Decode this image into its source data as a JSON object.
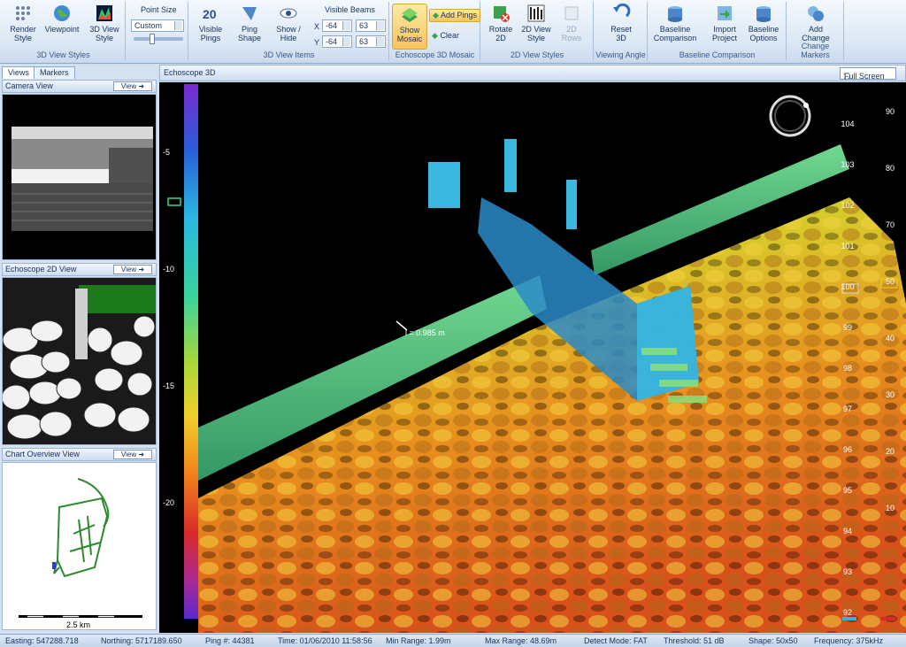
{
  "ribbon": {
    "render_style": "Render\nStyle",
    "viewpoint": "Viewpoint",
    "view_style_3d": "3D View\nStyle",
    "point_size_label": "Point Size",
    "point_size_value": "Custom",
    "group_3d_view_styles": "3D View Styles",
    "visible_pings": "Visible\nPings",
    "ping_shape": "Ping\nShape",
    "show_hide": "Show /\nHide",
    "group_3d_view_items": "3D View Items",
    "visible_beams_label": "Visible Beams",
    "x_label": "X",
    "y_label": "Y",
    "x_min": "-64",
    "x_max": "63",
    "y_min": "-64",
    "y_max": "63",
    "show_mosaic": "Show\nMosaic",
    "add_pings": "Add Pings",
    "clear": "Clear",
    "group_mosaic": "Echoscope 3D Mosaic",
    "rotate_2d": "Rotate\n2D",
    "view_style_2d": "2D View\nStyle",
    "rows_2d": "2D\nRows",
    "group_2d_view_styles": "2D View Styles",
    "reset_3d": "Reset\n3D",
    "group_viewing_angle": "Viewing Angle",
    "baseline_comparison": "Baseline\nComparison",
    "import_project": "Import\nProject",
    "baseline_options": "Baseline\nOptions",
    "group_baseline": "Baseline Comparison",
    "add_change": "Add\nChange",
    "group_change_markers": "Change Markers"
  },
  "left": {
    "tab_views": "Views",
    "tab_markers": "Markers",
    "camera_view": "Camera View",
    "echoscope_2d_view": "Echoscope 2D View",
    "chart_overview_view": "Chart Overview View",
    "view_button": "View",
    "scale_label": "2.5 km"
  },
  "main": {
    "title": "Echoscope 3D",
    "full_screen": "Full Screen",
    "measurement": "l = 0.985 m",
    "depth_ticks": [
      "-5",
      "-10",
      "-15",
      "-20"
    ],
    "right_ticks_inner": [
      "104",
      "103",
      "102",
      "101",
      "100",
      "99",
      "98",
      "97",
      "96",
      "95",
      "94",
      "93",
      "92"
    ],
    "right_ticks_outer": [
      "90",
      "80",
      "70",
      "50",
      "40",
      "30",
      "20",
      "10"
    ]
  },
  "status": {
    "easting": "Easting:  547288.718",
    "northing": "Northing:  5717189.650",
    "ping": "Ping #:  44381",
    "time": "Time:  01/06/2010 11:58:56",
    "min_range": "Min Range:  1.99m",
    "max_range": "Max Range:  48.69m",
    "detect_mode": "Detect Mode:  FAT",
    "threshold": "Threshold:  51 dB",
    "shape": "Shape:  50x50",
    "frequency": "Frequency:  375kHz"
  }
}
